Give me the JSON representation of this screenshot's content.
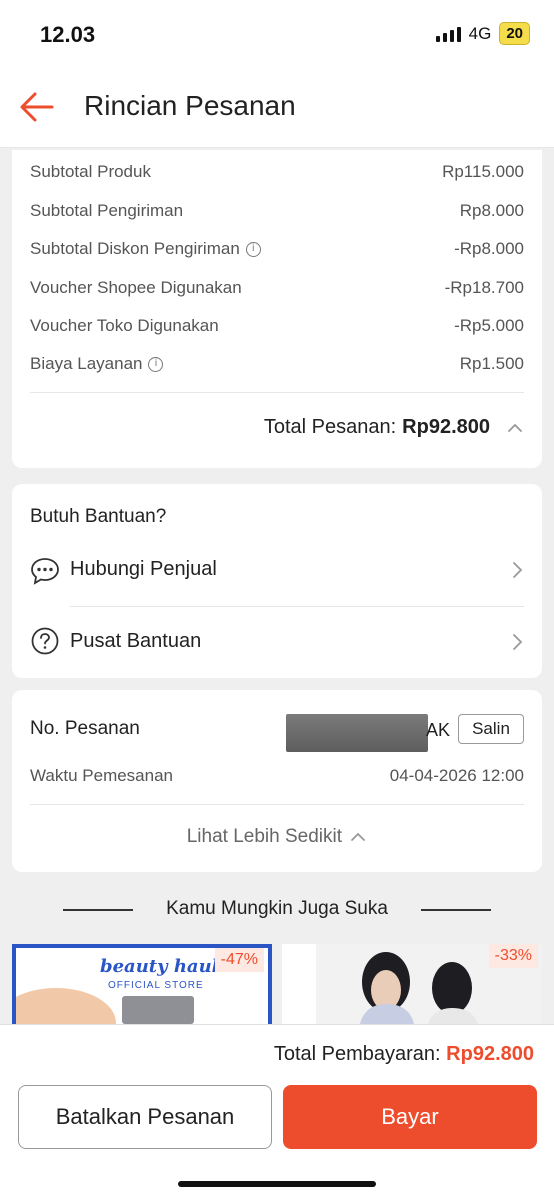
{
  "status_bar": {
    "time": "12.03",
    "network": "4G",
    "battery": "20"
  },
  "header": {
    "title": "Rincian Pesanan"
  },
  "summary": {
    "rows": [
      {
        "label": "Subtotal Produk",
        "value": "Rp115.000"
      },
      {
        "label": "Subtotal Pengiriman",
        "value": "Rp8.000"
      },
      {
        "label": "Subtotal Diskon Pengiriman",
        "value": "-Rp8.000"
      },
      {
        "label": "Voucher Shopee Digunakan",
        "value": "-Rp18.700"
      },
      {
        "label": "Voucher Toko Digunakan",
        "value": "-Rp5.000"
      },
      {
        "label": "Biaya Layanan",
        "value": "Rp1.500"
      }
    ],
    "total_label": "Total Pesanan:",
    "total_value": "Rp92.800"
  },
  "help": {
    "title": "Butuh Bantuan?",
    "items": [
      {
        "label": "Hubungi Penjual",
        "icon": "chat-icon"
      },
      {
        "label": "Pusat Bantuan",
        "icon": "question-icon"
      }
    ]
  },
  "order": {
    "number_label": "No. Pesanan",
    "number_suffix": "AK",
    "copy_label": "Salin",
    "time_label": "Waktu Pemesanan",
    "time_value": "04-04-2026 12:00",
    "toggle_label": "Lihat Lebih Sedikit"
  },
  "recommendations": {
    "title": "Kamu Mungkin Juga Suka",
    "products": [
      {
        "discount": "-47%",
        "brand": "beauty haul",
        "brand_sub": "OFFICIAL STORE"
      },
      {
        "discount": "-33%"
      }
    ]
  },
  "footer": {
    "total_label": "Total Pembayaran:",
    "total_value": "Rp92.800",
    "cancel_label": "Batalkan Pesanan",
    "pay_label": "Bayar"
  },
  "colors": {
    "accent": "#ee4d2d",
    "brand_blue": "#2b55c5"
  }
}
